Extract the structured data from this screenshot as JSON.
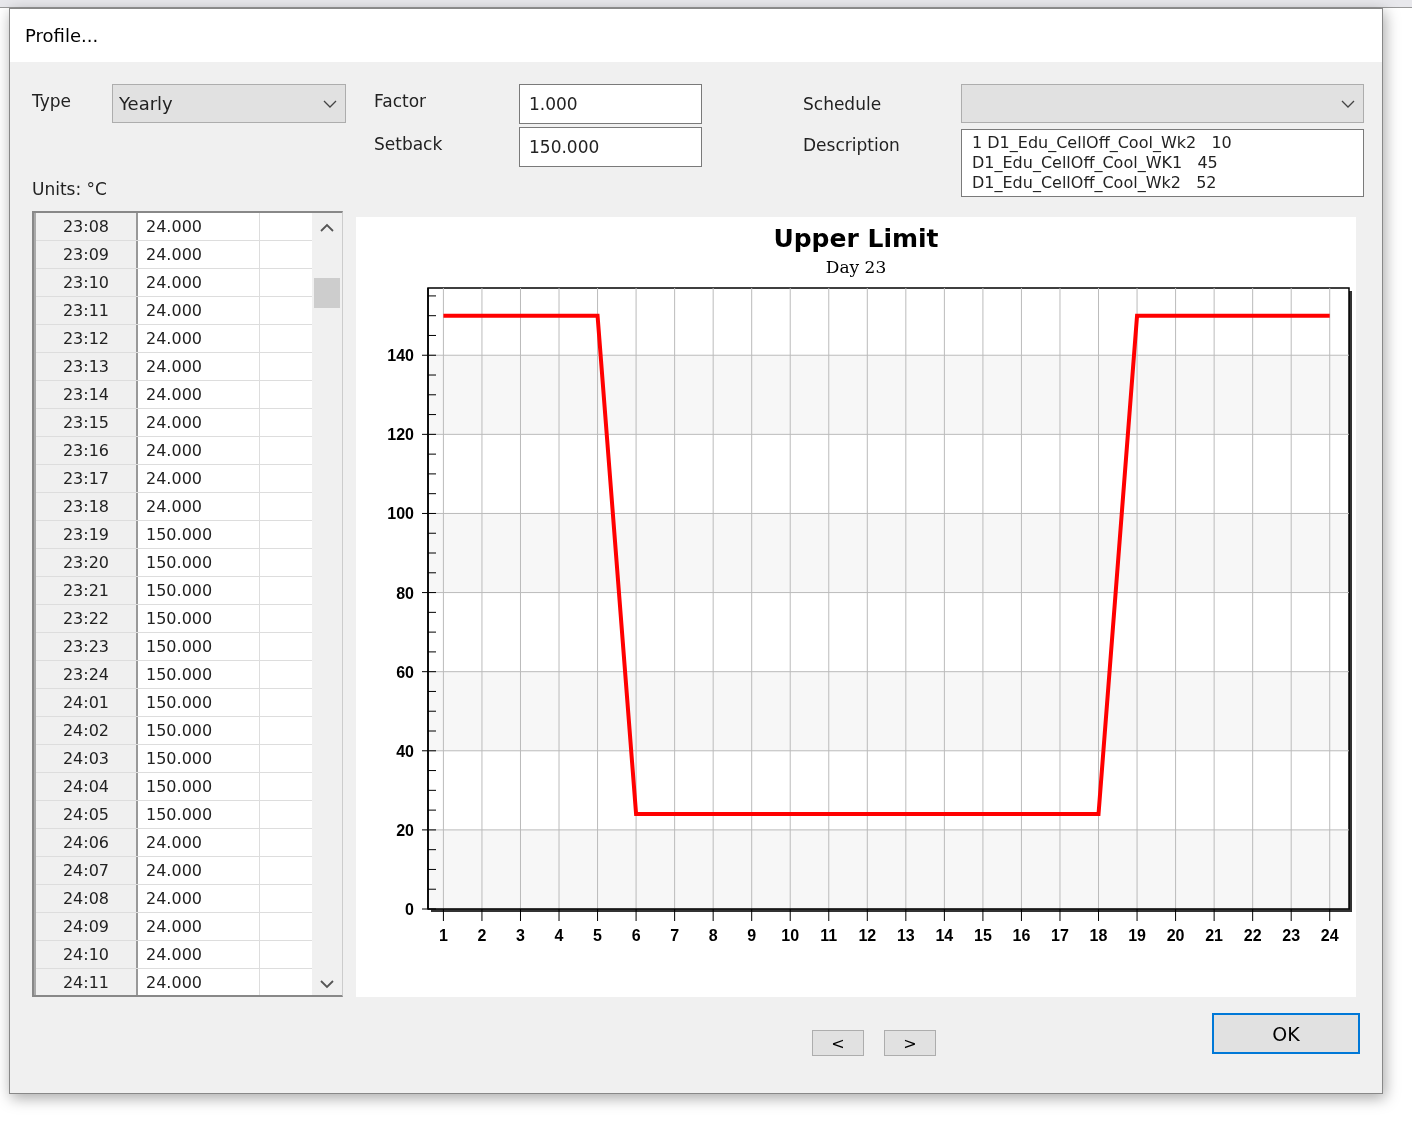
{
  "window": {
    "title": "Profile..."
  },
  "type": {
    "label": "Type",
    "value": "Yearly"
  },
  "factor": {
    "label": "Factor",
    "value": "1.000"
  },
  "setback": {
    "label": "Setback",
    "value": "150.000"
  },
  "schedule": {
    "label": "Schedule"
  },
  "description": {
    "label": "Description",
    "lines": [
      "1 D1_Edu_CellOff_Cool_Wk2   10",
      "D1_Edu_CellOff_Cool_WK1   45",
      "D1_Edu_CellOff_Cool_Wk2   52"
    ]
  },
  "units": "Units: °C",
  "table": {
    "rows": [
      {
        "time": "23:08",
        "value": "24.000"
      },
      {
        "time": "23:09",
        "value": "24.000"
      },
      {
        "time": "23:10",
        "value": "24.000"
      },
      {
        "time": "23:11",
        "value": "24.000"
      },
      {
        "time": "23:12",
        "value": "24.000"
      },
      {
        "time": "23:13",
        "value": "24.000"
      },
      {
        "time": "23:14",
        "value": "24.000"
      },
      {
        "time": "23:15",
        "value": "24.000"
      },
      {
        "time": "23:16",
        "value": "24.000"
      },
      {
        "time": "23:17",
        "value": "24.000"
      },
      {
        "time": "23:18",
        "value": "24.000"
      },
      {
        "time": "23:19",
        "value": "150.000"
      },
      {
        "time": "23:20",
        "value": "150.000"
      },
      {
        "time": "23:21",
        "value": "150.000"
      },
      {
        "time": "23:22",
        "value": "150.000"
      },
      {
        "time": "23:23",
        "value": "150.000"
      },
      {
        "time": "23:24",
        "value": "150.000"
      },
      {
        "time": "24:01",
        "value": "150.000"
      },
      {
        "time": "24:02",
        "value": "150.000"
      },
      {
        "time": "24:03",
        "value": "150.000"
      },
      {
        "time": "24:04",
        "value": "150.000"
      },
      {
        "time": "24:05",
        "value": "150.000"
      },
      {
        "time": "24:06",
        "value": "24.000"
      },
      {
        "time": "24:07",
        "value": "24.000"
      },
      {
        "time": "24:08",
        "value": "24.000"
      },
      {
        "time": "24:09",
        "value": "24.000"
      },
      {
        "time": "24:10",
        "value": "24.000"
      },
      {
        "time": "24:11",
        "value": "24.000"
      }
    ]
  },
  "chart_data": {
    "type": "line",
    "title": "Upper Limit",
    "subtitle": "Day 23",
    "x": [
      1,
      2,
      3,
      4,
      5,
      6,
      7,
      8,
      9,
      10,
      11,
      12,
      13,
      14,
      15,
      16,
      17,
      18,
      19,
      20,
      21,
      22,
      23,
      24
    ],
    "grid": true,
    "series": [
      {
        "color": "#ff0000",
        "values": [
          150,
          150,
          150,
          150,
          150,
          24,
          24,
          24,
          24,
          24,
          24,
          24,
          24,
          24,
          24,
          24,
          24,
          24,
          150,
          150,
          150,
          150,
          150,
          150
        ]
      }
    ],
    "xlim": [
      0.6,
      24.5
    ],
    "ylim": [
      0,
      157
    ],
    "xticks": [
      1,
      2,
      3,
      4,
      5,
      6,
      7,
      8,
      9,
      10,
      11,
      12,
      13,
      14,
      15,
      16,
      17,
      18,
      19,
      20,
      21,
      22,
      23,
      24
    ],
    "yticks": [
      0,
      20,
      40,
      60,
      80,
      100,
      120,
      140
    ]
  },
  "nav_buttons": [
    "<",
    ">"
  ],
  "ok_button": "OK"
}
